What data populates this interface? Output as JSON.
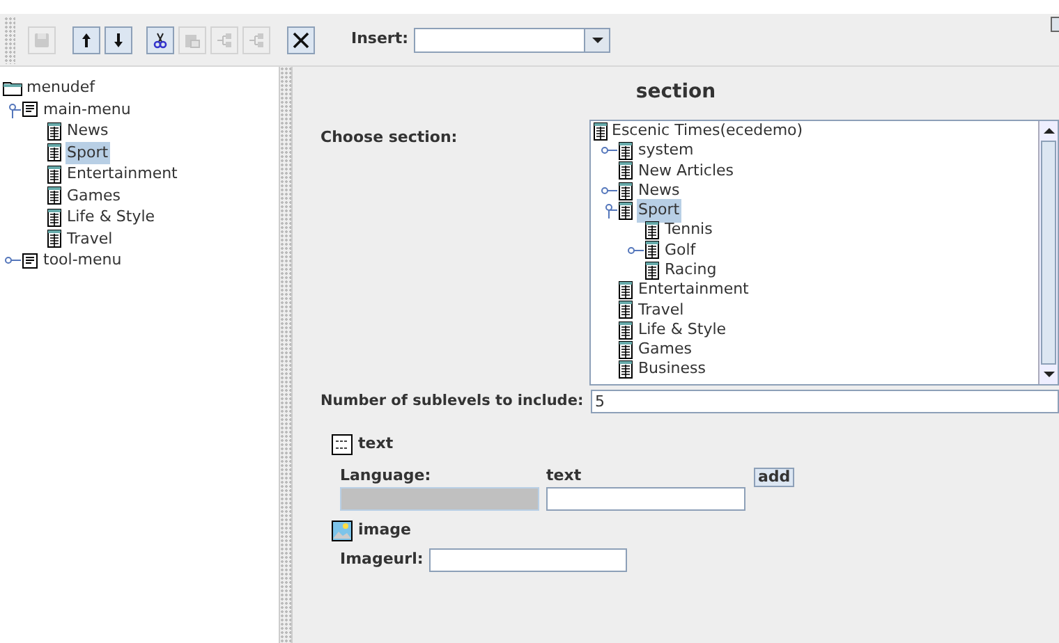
{
  "toolbar": {
    "buttons": [
      {
        "kind": "save",
        "disabled": true
      },
      {
        "kind": "up",
        "disabled": false
      },
      {
        "kind": "down",
        "disabled": false
      },
      {
        "kind": "cut",
        "disabled": false
      },
      {
        "kind": "paste",
        "disabled": true
      },
      {
        "kind": "tree",
        "disabled": true
      },
      {
        "kind": "tree",
        "disabled": true
      },
      {
        "kind": "delete",
        "disabled": false
      }
    ],
    "insert_label": "Insert:"
  },
  "menu_tree": {
    "root": "menudef",
    "items": [
      {
        "label": "main-menu",
        "kind": "menu",
        "expanded": true,
        "selected": false,
        "children": [
          {
            "label": "News",
            "kind": "section",
            "selected": false
          },
          {
            "label": "Sport",
            "kind": "section",
            "selected": true
          },
          {
            "label": "Entertainment",
            "kind": "section",
            "selected": false
          },
          {
            "label": "Games",
            "kind": "section",
            "selected": false
          },
          {
            "label": "Life & Style",
            "kind": "section",
            "selected": false
          },
          {
            "label": "Travel",
            "kind": "section",
            "selected": false
          }
        ]
      },
      {
        "label": "tool-menu",
        "kind": "menu",
        "expanded": false,
        "selected": false
      }
    ]
  },
  "form": {
    "title": "section",
    "choose_label": "Choose section:",
    "section_tree": {
      "root": "Escenic Times(ecedemo)",
      "items": [
        {
          "label": "system",
          "kind": "branch",
          "expanded": false,
          "selected": false
        },
        {
          "label": "New Articles",
          "kind": "leaf",
          "selected": false
        },
        {
          "label": "News",
          "kind": "branch",
          "expanded": false,
          "selected": false
        },
        {
          "label": "Sport",
          "kind": "branch",
          "expanded": true,
          "selected": true,
          "children": [
            {
              "label": "Tennis",
              "kind": "leaf",
              "selected": false
            },
            {
              "label": "Golf",
              "kind": "branch",
              "expanded": false,
              "selected": false
            },
            {
              "label": "Racing",
              "kind": "leaf",
              "selected": false
            }
          ]
        },
        {
          "label": "Entertainment",
          "kind": "leaf",
          "selected": false
        },
        {
          "label": "Travel",
          "kind": "leaf",
          "selected": false
        },
        {
          "label": "Life & Style",
          "kind": "leaf",
          "selected": false
        },
        {
          "label": "Games",
          "kind": "leaf",
          "selected": false
        },
        {
          "label": "Business",
          "kind": "leaf",
          "selected": false
        }
      ]
    },
    "sublevels_label": "Number of sublevels to include:",
    "sublevels_value": "5",
    "text_group": {
      "title": "text",
      "language_label": "Language:",
      "text_label": "text",
      "add_button": "add"
    },
    "image_group": {
      "title": "image",
      "url_label": "Imageurl:"
    }
  }
}
